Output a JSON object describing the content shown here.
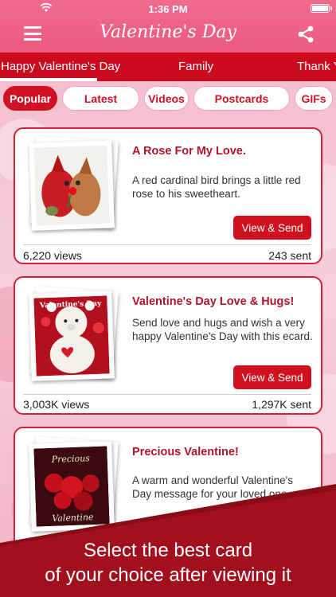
{
  "status_bar": {
    "time": "1:36 PM"
  },
  "header": {
    "title": "Valentine's Day"
  },
  "tabs": [
    {
      "label": "Happy Valentine's Day"
    },
    {
      "label": "Family"
    },
    {
      "label": "Thank Y"
    }
  ],
  "filters": [
    {
      "label": "Popular"
    },
    {
      "label": "Latest"
    },
    {
      "label": "Videos"
    },
    {
      "label": "Postcards"
    },
    {
      "label": "GIFs"
    }
  ],
  "cards": [
    {
      "title": "A Rose For My Love.",
      "description": "A red cardinal bird brings a little red rose to his sweetheart.",
      "button": "View & Send",
      "views": "6,220 views",
      "sent": "243 sent"
    },
    {
      "title": "Valentine's Day Love & Hugs!",
      "description": "Send love and hugs and wish a very happy Valentine's Day with this ecard.",
      "button": "View & Send",
      "views": "3,003K views",
      "sent": "1,297K sent",
      "thumb_text": "Valentine's Day"
    },
    {
      "title": "Precious Valentine!",
      "description": "A warm and wonderful Valentine's Day message for your loved one",
      "thumb_text_top": "Precious",
      "thumb_text_bottom": "Valentine"
    }
  ],
  "banner": {
    "line1": "Select the best card",
    "line2": "of your choice after viewing it"
  },
  "colors": {
    "header": "#ec5a80",
    "tabs": "#cc0a1e",
    "accent": "#d0101f"
  }
}
